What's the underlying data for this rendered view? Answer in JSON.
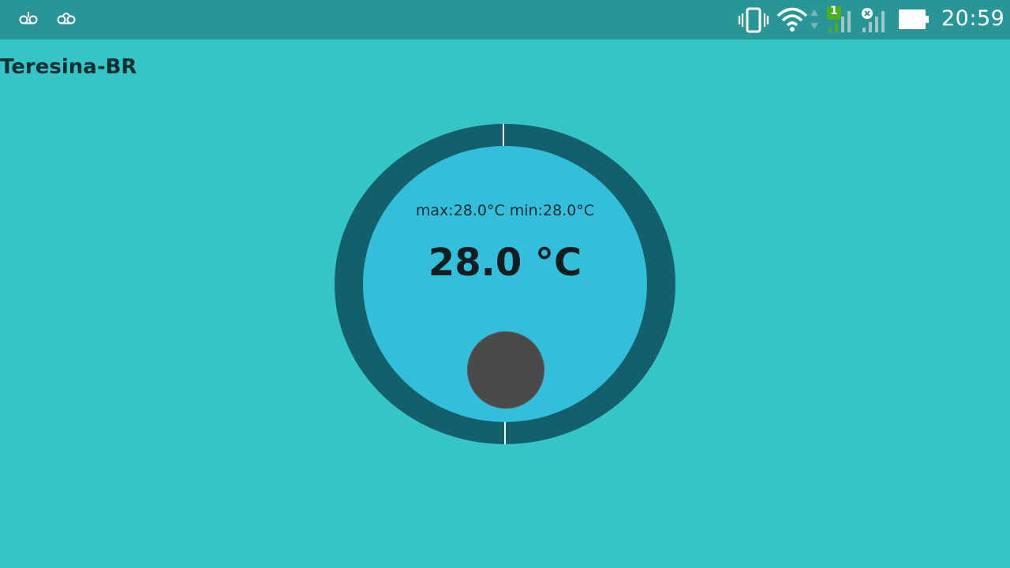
{
  "status_bar": {
    "time": "20:59",
    "sim_label": "1",
    "icons": [
      "voicemail-icon",
      "voicemail-icon",
      "vibrate-icon",
      "wifi-icon",
      "data-arrows-icon",
      "signal-sim1-icon",
      "signal-sim2-no-service-icon",
      "battery-icon"
    ]
  },
  "weather": {
    "location": "Teresina-BR",
    "minmax": "max:28.0°C min:28.0°C",
    "temperature": "28.0 °C"
  },
  "colors": {
    "background": "#36c5c6",
    "status_bar": "#2a9596",
    "gauge_ring": "#135f6c",
    "gauge_face": "#33bedb",
    "knob": "#4a4a4c"
  }
}
